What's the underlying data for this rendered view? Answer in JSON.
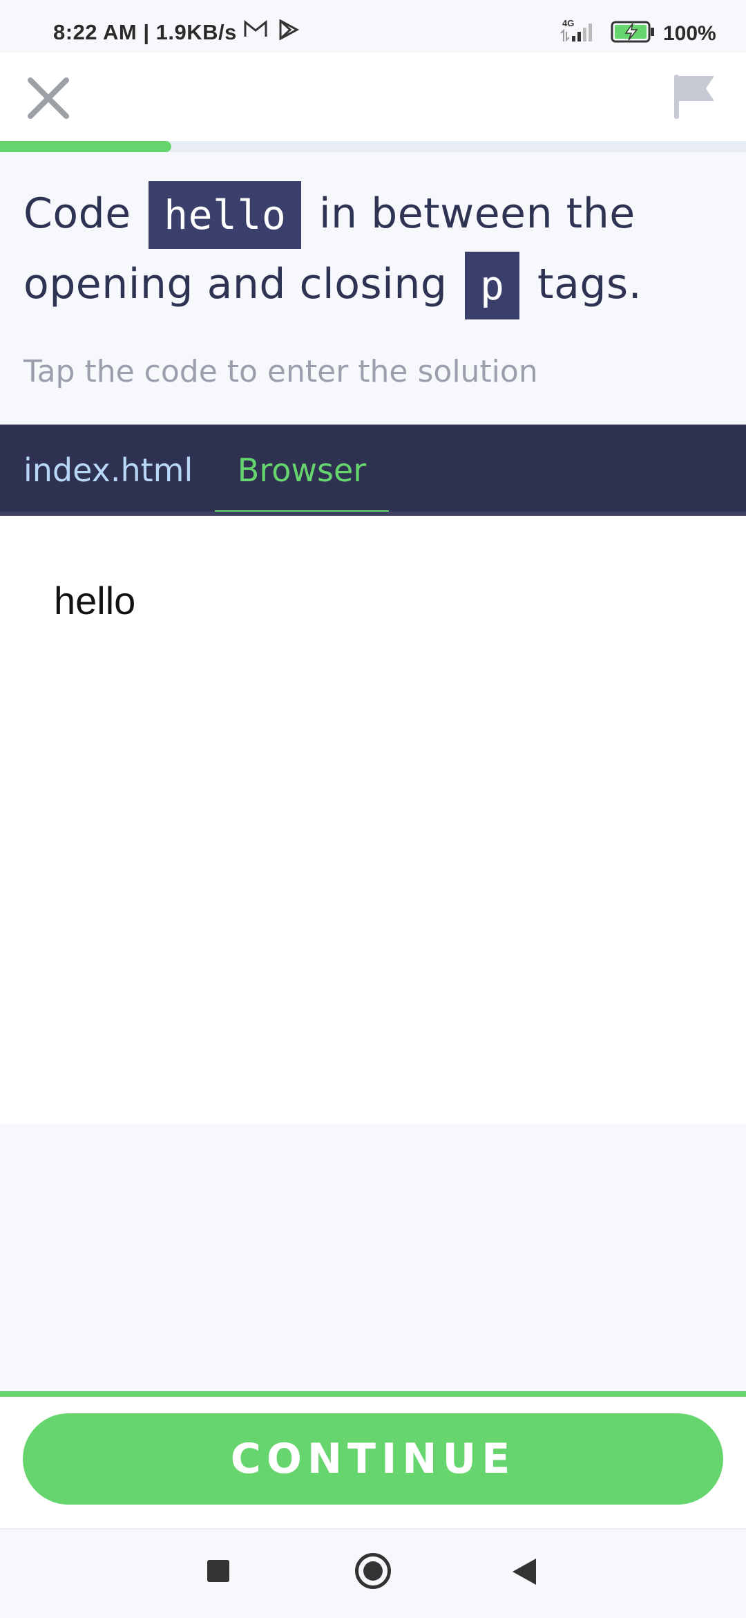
{
  "status_bar": {
    "time": "8:22 AM | 1.9KB/s",
    "network": "4G",
    "battery": "100%",
    "icons": [
      "mail-icon",
      "play-store-icon",
      "signal-icon",
      "battery-charging-icon"
    ]
  },
  "top_bar": {
    "close_icon": "close-icon",
    "flag_icon": "flag-icon"
  },
  "progress": {
    "fraction": 0.23
  },
  "question": {
    "part1": "Code",
    "code1": "hello",
    "part2": "in between the opening and closing",
    "code2": "p",
    "part3": "tags."
  },
  "hint": "Tap the code to enter the solution",
  "tabs": [
    {
      "label": "index.html",
      "active": false
    },
    {
      "label": "Browser",
      "active": true
    }
  ],
  "browser": {
    "output": "hello"
  },
  "continue_label": "CONTINUE",
  "colors": {
    "accent": "#66d56e",
    "dark": "#2f3150",
    "chip": "#3b3f6c",
    "text": "#2e3354"
  }
}
